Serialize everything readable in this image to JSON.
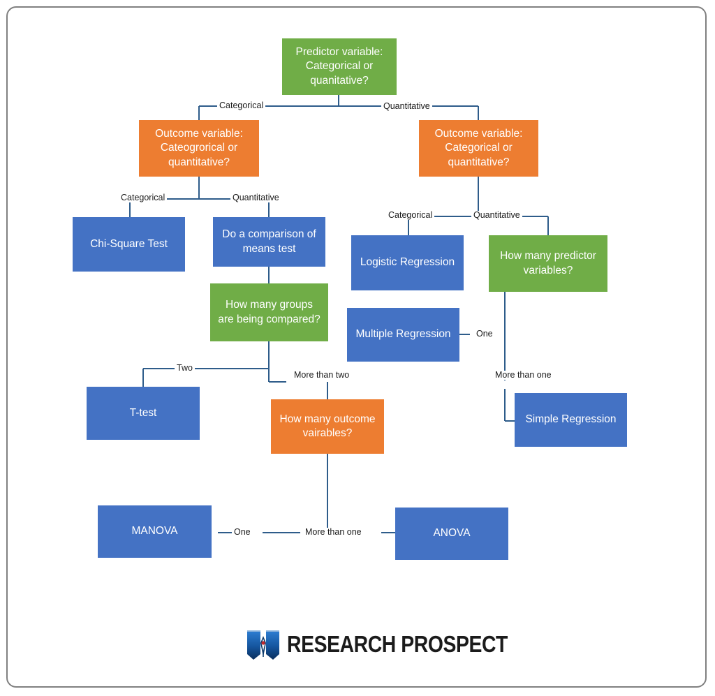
{
  "diagram": {
    "title": "Statistical Test Selection Flowchart",
    "colors": {
      "green": "#70AD47",
      "orange": "#ED7D31",
      "blue": "#4472C4",
      "connector": "#2E5C8A",
      "frame": "#808080"
    },
    "nodes": {
      "predictor_variable": "Predictor variable: Categorical or quanitative?",
      "outcome_variable_left": "Outcome variable: Cateogrorical or quantitative?",
      "outcome_variable_right": "Outcome variable: Categorical or quantitative?",
      "chi_square_test": "Chi-Square Test",
      "comparison_of_means": "Do a comparison of means test",
      "how_many_groups": "How many groups are being compared?",
      "logistic_regression": "Logistic Regression",
      "multiple_regression": "Multiple Regression",
      "how_many_predictors": "How many predictor variables?",
      "t_test": "T-test",
      "how_many_outcomes": "How many outcome vairables?",
      "simple_regression": "Simple Regression",
      "manova": "MANOVA",
      "anova": "ANOVA"
    },
    "edge_labels": {
      "root_categorical": "Categorical",
      "root_quantitative": "Quantitative",
      "left_categorical": "Categorical",
      "left_quantitative": "Quantitative",
      "right_categorical": "Categorical",
      "right_quantitative": "Quantitative",
      "groups_two": "Two",
      "groups_more_than_two": "More than two",
      "predictors_one": "One",
      "predictors_more_than_one": "More than one",
      "outcomes_one": "One",
      "outcomes_more_than_one": "More than one"
    }
  },
  "logo": {
    "brand": "RESEARCH PROSPECT",
    "mark": "open-book-pen-icon"
  }
}
